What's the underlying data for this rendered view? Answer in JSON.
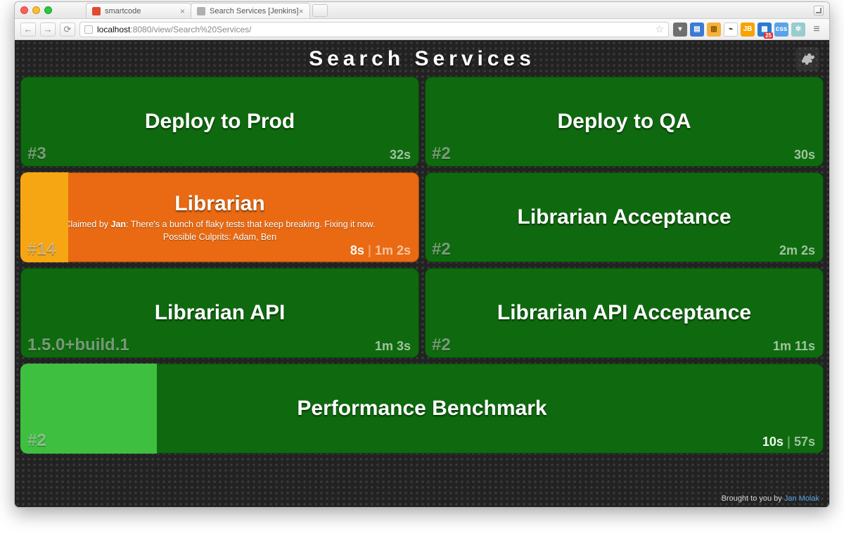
{
  "browser": {
    "tabs": [
      {
        "title": "smartcode",
        "favicon_color": "#e14b32",
        "active": false
      },
      {
        "title": "Search Services [Jenkins]",
        "favicon_color": "#b0b0b0",
        "active": true
      }
    ],
    "nav": {
      "back": "←",
      "forward": "→",
      "reload": "⟳"
    },
    "url_host": "localhost",
    "url_port": ":8080",
    "url_path": "/view/Search%20Services/",
    "star": "☆",
    "extensions": {
      "pocket": "▾",
      "wallet": "▤",
      "layers": "▥",
      "mask": "⌁",
      "jb": "JB",
      "calendar": "▦",
      "calendar_badge": "25",
      "css": "css",
      "globe": "✲"
    },
    "menu": "≡"
  },
  "page": {
    "title": "Search Services",
    "footer_prefix": "Brought to you by ",
    "footer_link": "Jan Molak"
  },
  "cards": [
    {
      "id": "deploy-prod",
      "title": "Deploy to Prod",
      "status": "green",
      "bottom_left": "#3",
      "duration": "32s",
      "wide": false
    },
    {
      "id": "deploy-qa",
      "title": "Deploy to QA",
      "status": "green",
      "bottom_left": "#2",
      "duration": "30s",
      "wide": false
    },
    {
      "id": "librarian",
      "title": "Librarian",
      "status": "orange",
      "bottom_left": "#14",
      "claim_prefix": "Claimed by ",
      "claim_by": "Jan",
      "claim_msg": ": There's a bunch of flaky tests that keep breaking. Fixing it now.",
      "culprits": "Possible Culprits: Adam,  Ben",
      "eta": "8s",
      "duration": "1m 2s",
      "progress_pct": 12,
      "progress_color": "amber",
      "wide": false
    },
    {
      "id": "librarian-acceptance",
      "title": "Librarian Acceptance",
      "status": "green",
      "bottom_left": "#2",
      "duration": "2m 2s",
      "wide": false
    },
    {
      "id": "librarian-api",
      "title": "Librarian API",
      "status": "green",
      "bottom_left": "1.5.0+build.1",
      "duration": "1m 3s",
      "wide": false
    },
    {
      "id": "librarian-api-acceptance",
      "title": "Librarian API Acceptance",
      "status": "green",
      "bottom_left": "#2",
      "duration": "1m 11s",
      "wide": false
    },
    {
      "id": "perf-bench",
      "title": "Performance Benchmark",
      "status": "green",
      "bottom_left": "#2",
      "eta": "10s",
      "duration": "57s",
      "progress_pct": 17,
      "progress_color": "bright",
      "wide": true
    }
  ]
}
